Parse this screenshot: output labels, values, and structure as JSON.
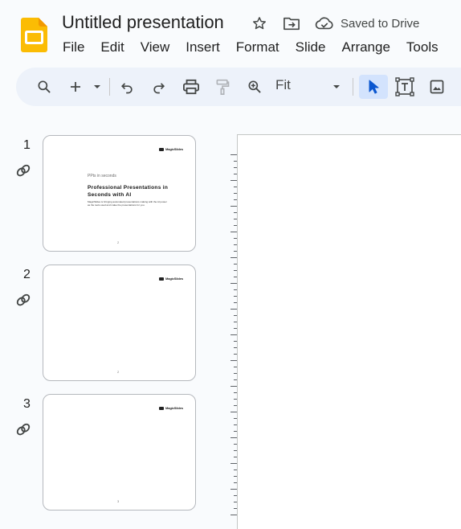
{
  "document": {
    "title": "Untitled presentation",
    "save_status": "Saved to Drive"
  },
  "menu": [
    "File",
    "Edit",
    "View",
    "Insert",
    "Format",
    "Slide",
    "Arrange",
    "Tools"
  ],
  "toolbar": {
    "zoom_label": "Fit"
  },
  "slides": [
    {
      "number": "1",
      "brand": "MagicSlides",
      "eyebrow": "PPts in seconds",
      "heading": "Professional Presentations in Seconds with AI",
      "subtext": "MagicSlides is bringing automated presentations making with the AI power as the tools used and make the presentations for you.",
      "page": "2"
    },
    {
      "number": "2",
      "brand": "MagicSlides",
      "page": "2"
    },
    {
      "number": "3",
      "brand": "MagicSlides",
      "page": "3"
    }
  ],
  "colors": {
    "logo": "#fbbc04",
    "toolbar_bg": "#edf2fa",
    "active_tool": "#d3e3fd",
    "page_bg": "#f9fbfd"
  },
  "icons": [
    "slides-logo-icon",
    "star-icon",
    "move-to-folder-icon",
    "cloud-check-icon",
    "search-icon",
    "plus-icon",
    "chevron-down-icon",
    "undo-icon",
    "redo-icon",
    "print-icon",
    "paint-format-icon",
    "zoom-icon",
    "select-cursor-icon",
    "text-box-icon",
    "image-icon",
    "link-icon"
  ]
}
